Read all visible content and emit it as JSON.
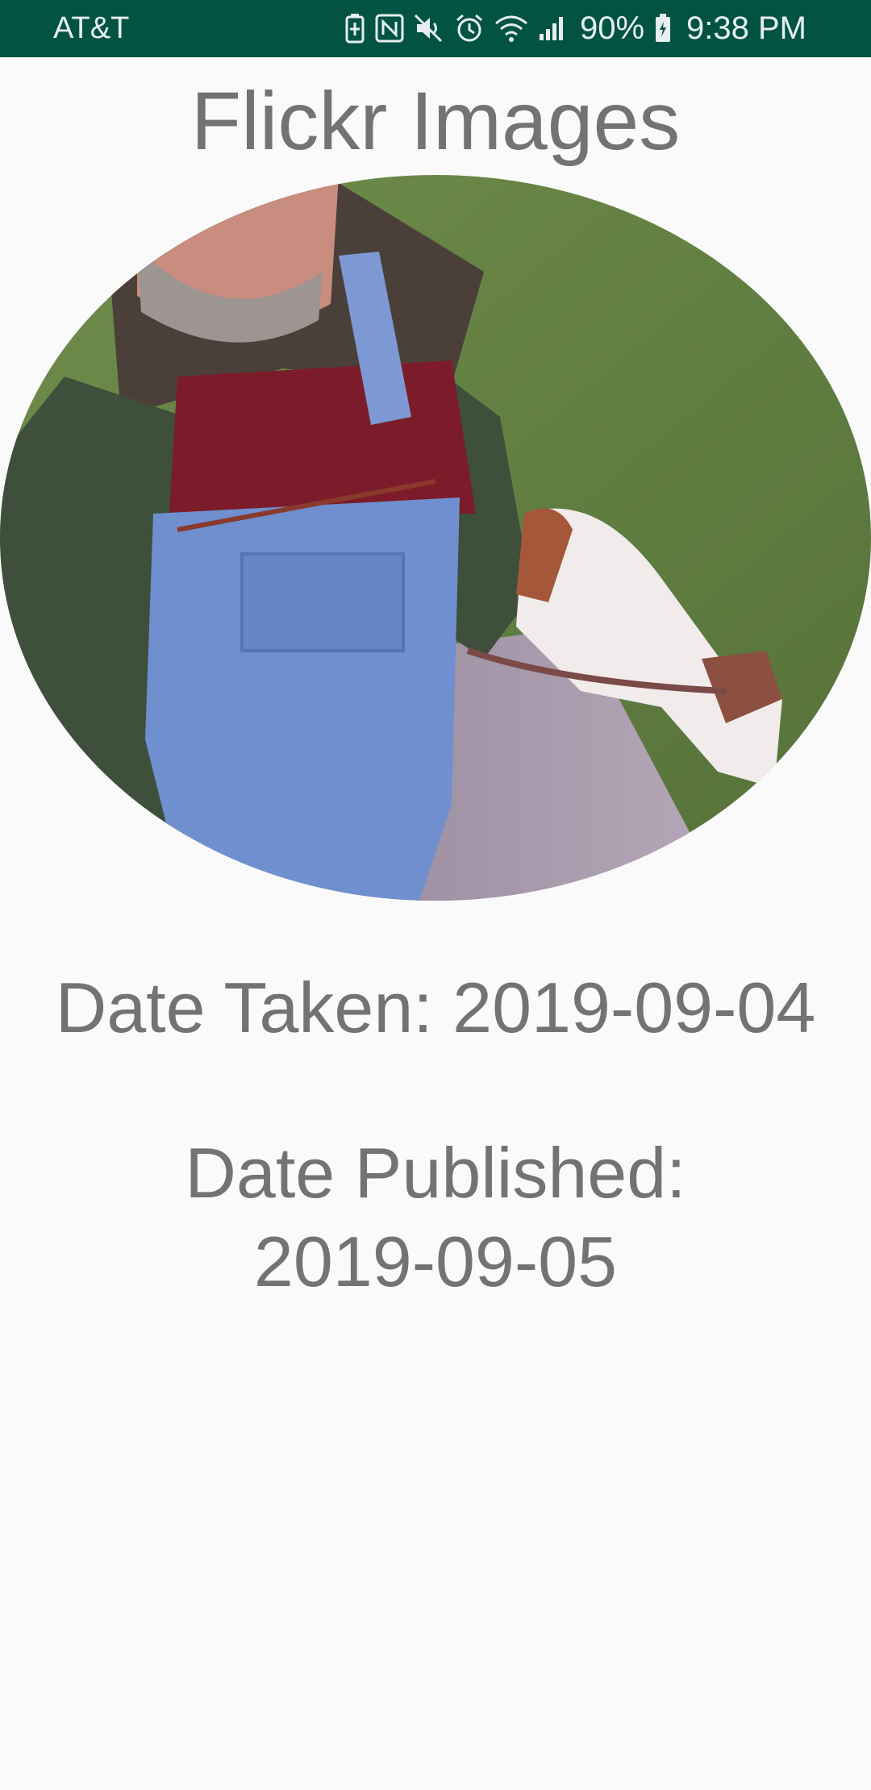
{
  "status_bar": {
    "carrier": "AT&T",
    "battery": "90%",
    "time": "9:38 PM",
    "icons": [
      "battery-saver-icon",
      "nfc-icon",
      "mute-icon",
      "alarm-icon",
      "wifi-icon",
      "signal-icon",
      "battery-icon"
    ],
    "background_color": "#035345"
  },
  "page": {
    "title": "Flickr Images"
  },
  "photo": {
    "shape": "ellipse"
  },
  "details": {
    "date_taken": "Date Taken: 2019-09-04",
    "date_published_label": "Date Published:",
    "date_published_value": "2019-09-05"
  }
}
